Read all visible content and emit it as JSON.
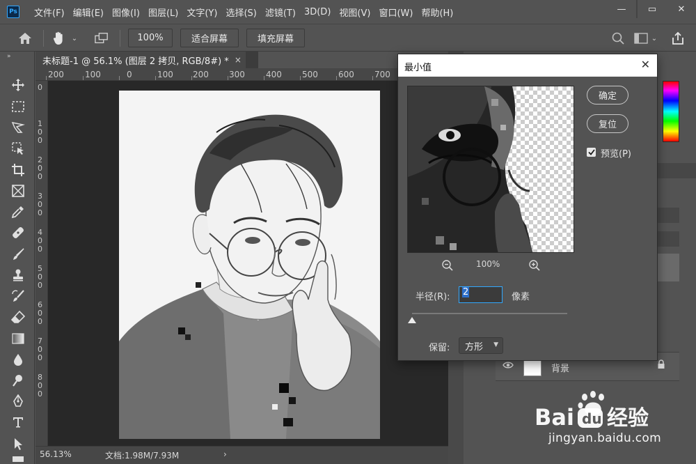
{
  "app": {
    "logo_text": "Ps"
  },
  "menu": {
    "items": [
      "文件(F)",
      "编辑(E)",
      "图像(I)",
      "图层(L)",
      "文字(Y)",
      "选择(S)",
      "滤镜(T)",
      "3D(D)",
      "视图(V)",
      "窗口(W)",
      "帮助(H)"
    ]
  },
  "window_controls": {
    "minimize": "—",
    "restore": "▭",
    "close": "✕"
  },
  "options_bar": {
    "zoom_value": "100%",
    "fit_screen": "适合屏幕",
    "fill_screen": "填充屏幕"
  },
  "document": {
    "tab_title": "未标题-1 @ 56.1% (图层 2 拷贝, RGB/8#) *",
    "tab_close": "×",
    "ruler_top": [
      "200",
      "100",
      "0",
      "100",
      "200",
      "300",
      "400",
      "500",
      "600",
      "700"
    ],
    "ruler_left": [
      "0",
      "100",
      "200",
      "300",
      "400",
      "500",
      "600",
      "700",
      "800"
    ]
  },
  "status": {
    "zoom": "56.13%",
    "doc_size": "文档:1.98M/7.93M",
    "arrow": "›"
  },
  "layers": {
    "background_name": "背景"
  },
  "dialog": {
    "title": "最小值",
    "ok": "确定",
    "reset": "复位",
    "preview_label": "预览(P)",
    "preview_checked": true,
    "zoom_percent": "100%",
    "radius_label": "半径(R):",
    "radius_value": "2",
    "radius_unit": "像素",
    "radius_slider_fraction": 0.0,
    "preserve_label": "保留:",
    "preserve_value": "方形"
  },
  "watermark": {
    "brand": "Bai du 经验",
    "url": "jingyan.baidu.com"
  },
  "colors": {
    "ui_bg": "#535353",
    "accent": "#31a8ff"
  }
}
